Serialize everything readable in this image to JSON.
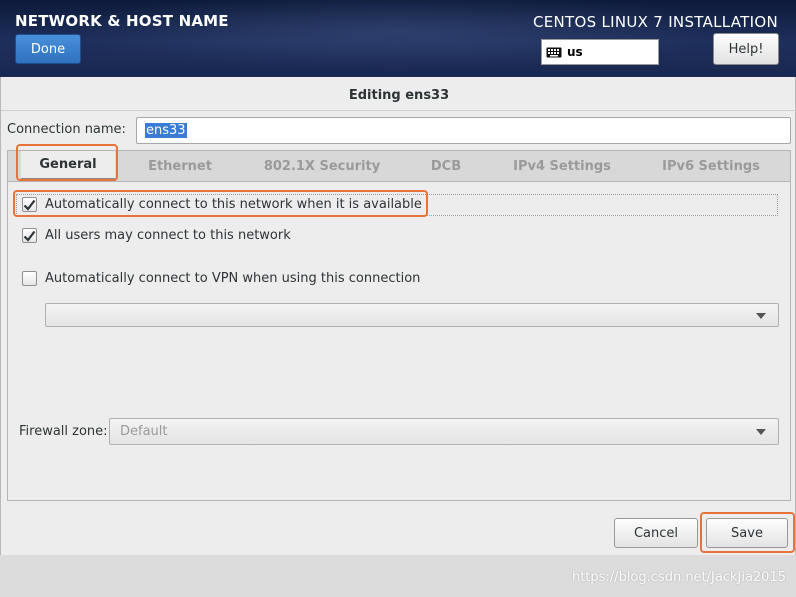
{
  "header": {
    "title": "NETWORK & HOST NAME",
    "done_label": "Done",
    "product": "CENTOS LINUX 7 INSTALLATION",
    "keyboard_layout": "us",
    "help_label": "Help!"
  },
  "dialog": {
    "title": "Editing ens33",
    "connection_name_label": "Connection name:",
    "connection_name_value": "ens33",
    "tabs": [
      {
        "label": "General",
        "active": true
      },
      {
        "label": "Ethernet",
        "active": false
      },
      {
        "label": "802.1X Security",
        "active": false
      },
      {
        "label": "DCB",
        "active": false
      },
      {
        "label": "IPv4 Settings",
        "active": false
      },
      {
        "label": "IPv6 Settings",
        "active": false
      }
    ],
    "general": {
      "auto_connect_label": "Automatically connect to this network when it is available",
      "auto_connect_checked": true,
      "all_users_label": "All users may connect to this network",
      "all_users_checked": true,
      "vpn_label": "Automatically connect to VPN when using this connection",
      "vpn_checked": false,
      "vpn_select_value": "",
      "firewall_label": "Firewall zone:",
      "firewall_value": "Default"
    },
    "cancel_label": "Cancel",
    "save_label": "Save"
  },
  "watermark": "https://blog.csdn.net/JackJia2015",
  "colors": {
    "header_bg": "#1e2f5c",
    "done_button": "#2e71c0",
    "highlight": "#e8733a",
    "selection": "#3a7bd5"
  }
}
